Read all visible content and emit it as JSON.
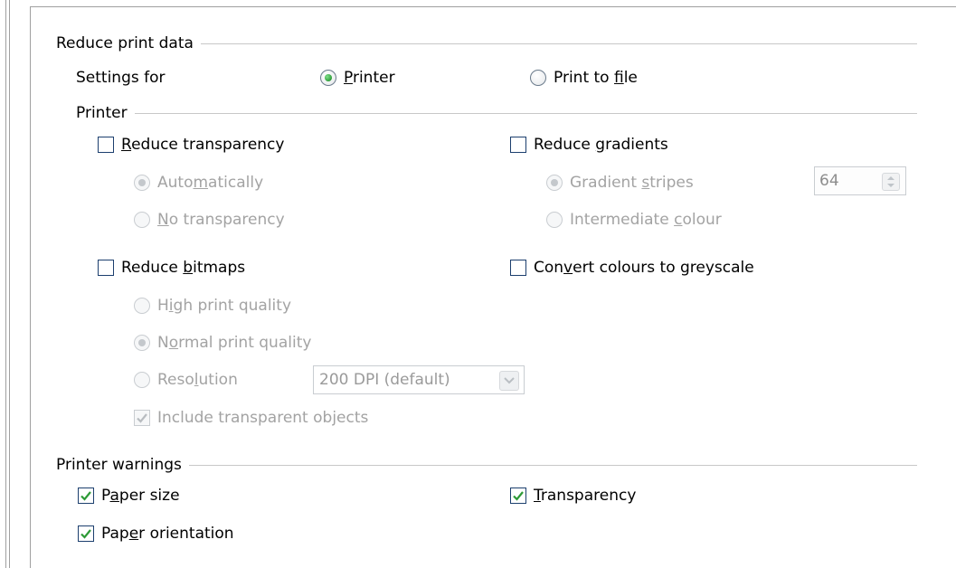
{
  "reduce_print_data": {
    "title": "Reduce print data",
    "settings_for": {
      "label": "Settings for",
      "printer": {
        "pre": "",
        "key": "P",
        "post": "rinter",
        "selected": true
      },
      "print_to_file": {
        "pre": "Print to ",
        "key": "f",
        "post": "ile",
        "selected": false
      }
    }
  },
  "printer": {
    "title": "Printer",
    "reduce_transparency": {
      "checkbox": {
        "pre": "",
        "key": "R",
        "post": "educe transparency",
        "checked": false
      },
      "automatically": {
        "pre": "Auto",
        "key": "m",
        "post": "atically",
        "selected": true
      },
      "no_transparency": {
        "pre": "",
        "key": "N",
        "post": "o transparency",
        "selected": false
      }
    },
    "reduce_gradients": {
      "checkbox": {
        "pre": "Reduce ",
        "key": "g",
        "post": "radients",
        "checked": false
      },
      "gradient_stripes": {
        "pre": "Gradient ",
        "key": "s",
        "post": "tripes",
        "selected": true,
        "value": "64"
      },
      "intermediate_colour": {
        "pre": "Intermediate ",
        "key": "c",
        "post": "olour",
        "selected": false
      }
    },
    "reduce_bitmaps": {
      "checkbox": {
        "pre": "Reduce ",
        "key": "b",
        "post": "itmaps",
        "checked": false
      },
      "high_quality": {
        "pre": "H",
        "key": "i",
        "post": "gh print quality",
        "selected": false
      },
      "normal_quality": {
        "pre": "N",
        "key": "o",
        "post": "rmal print quality",
        "selected": true
      },
      "resolution": {
        "pre": "Reso",
        "key": "l",
        "post": "ution",
        "selected": false,
        "value": "200 DPI (default)"
      },
      "include_transparent": {
        "pre": "Include transparent ob",
        "key": "j",
        "post": "ects",
        "checked": true
      }
    },
    "convert_greyscale": {
      "pre": "Con",
      "key": "v",
      "post": "ert colours to greyscale",
      "checked": false
    }
  },
  "printer_warnings": {
    "title": "Printer warnings",
    "paper_size": {
      "pre": "P",
      "key": "a",
      "post": "per size",
      "checked": true
    },
    "paper_orientation": {
      "pre": "Pap",
      "key": "e",
      "post": "r orientation",
      "checked": true
    },
    "transparency": {
      "pre": "",
      "key": "T",
      "post": "ransparency",
      "checked": true
    }
  },
  "colors": {
    "check_mark": "#2d9a36",
    "disabled_text": "#a3a3a3",
    "rule": "#c8c8c8"
  }
}
